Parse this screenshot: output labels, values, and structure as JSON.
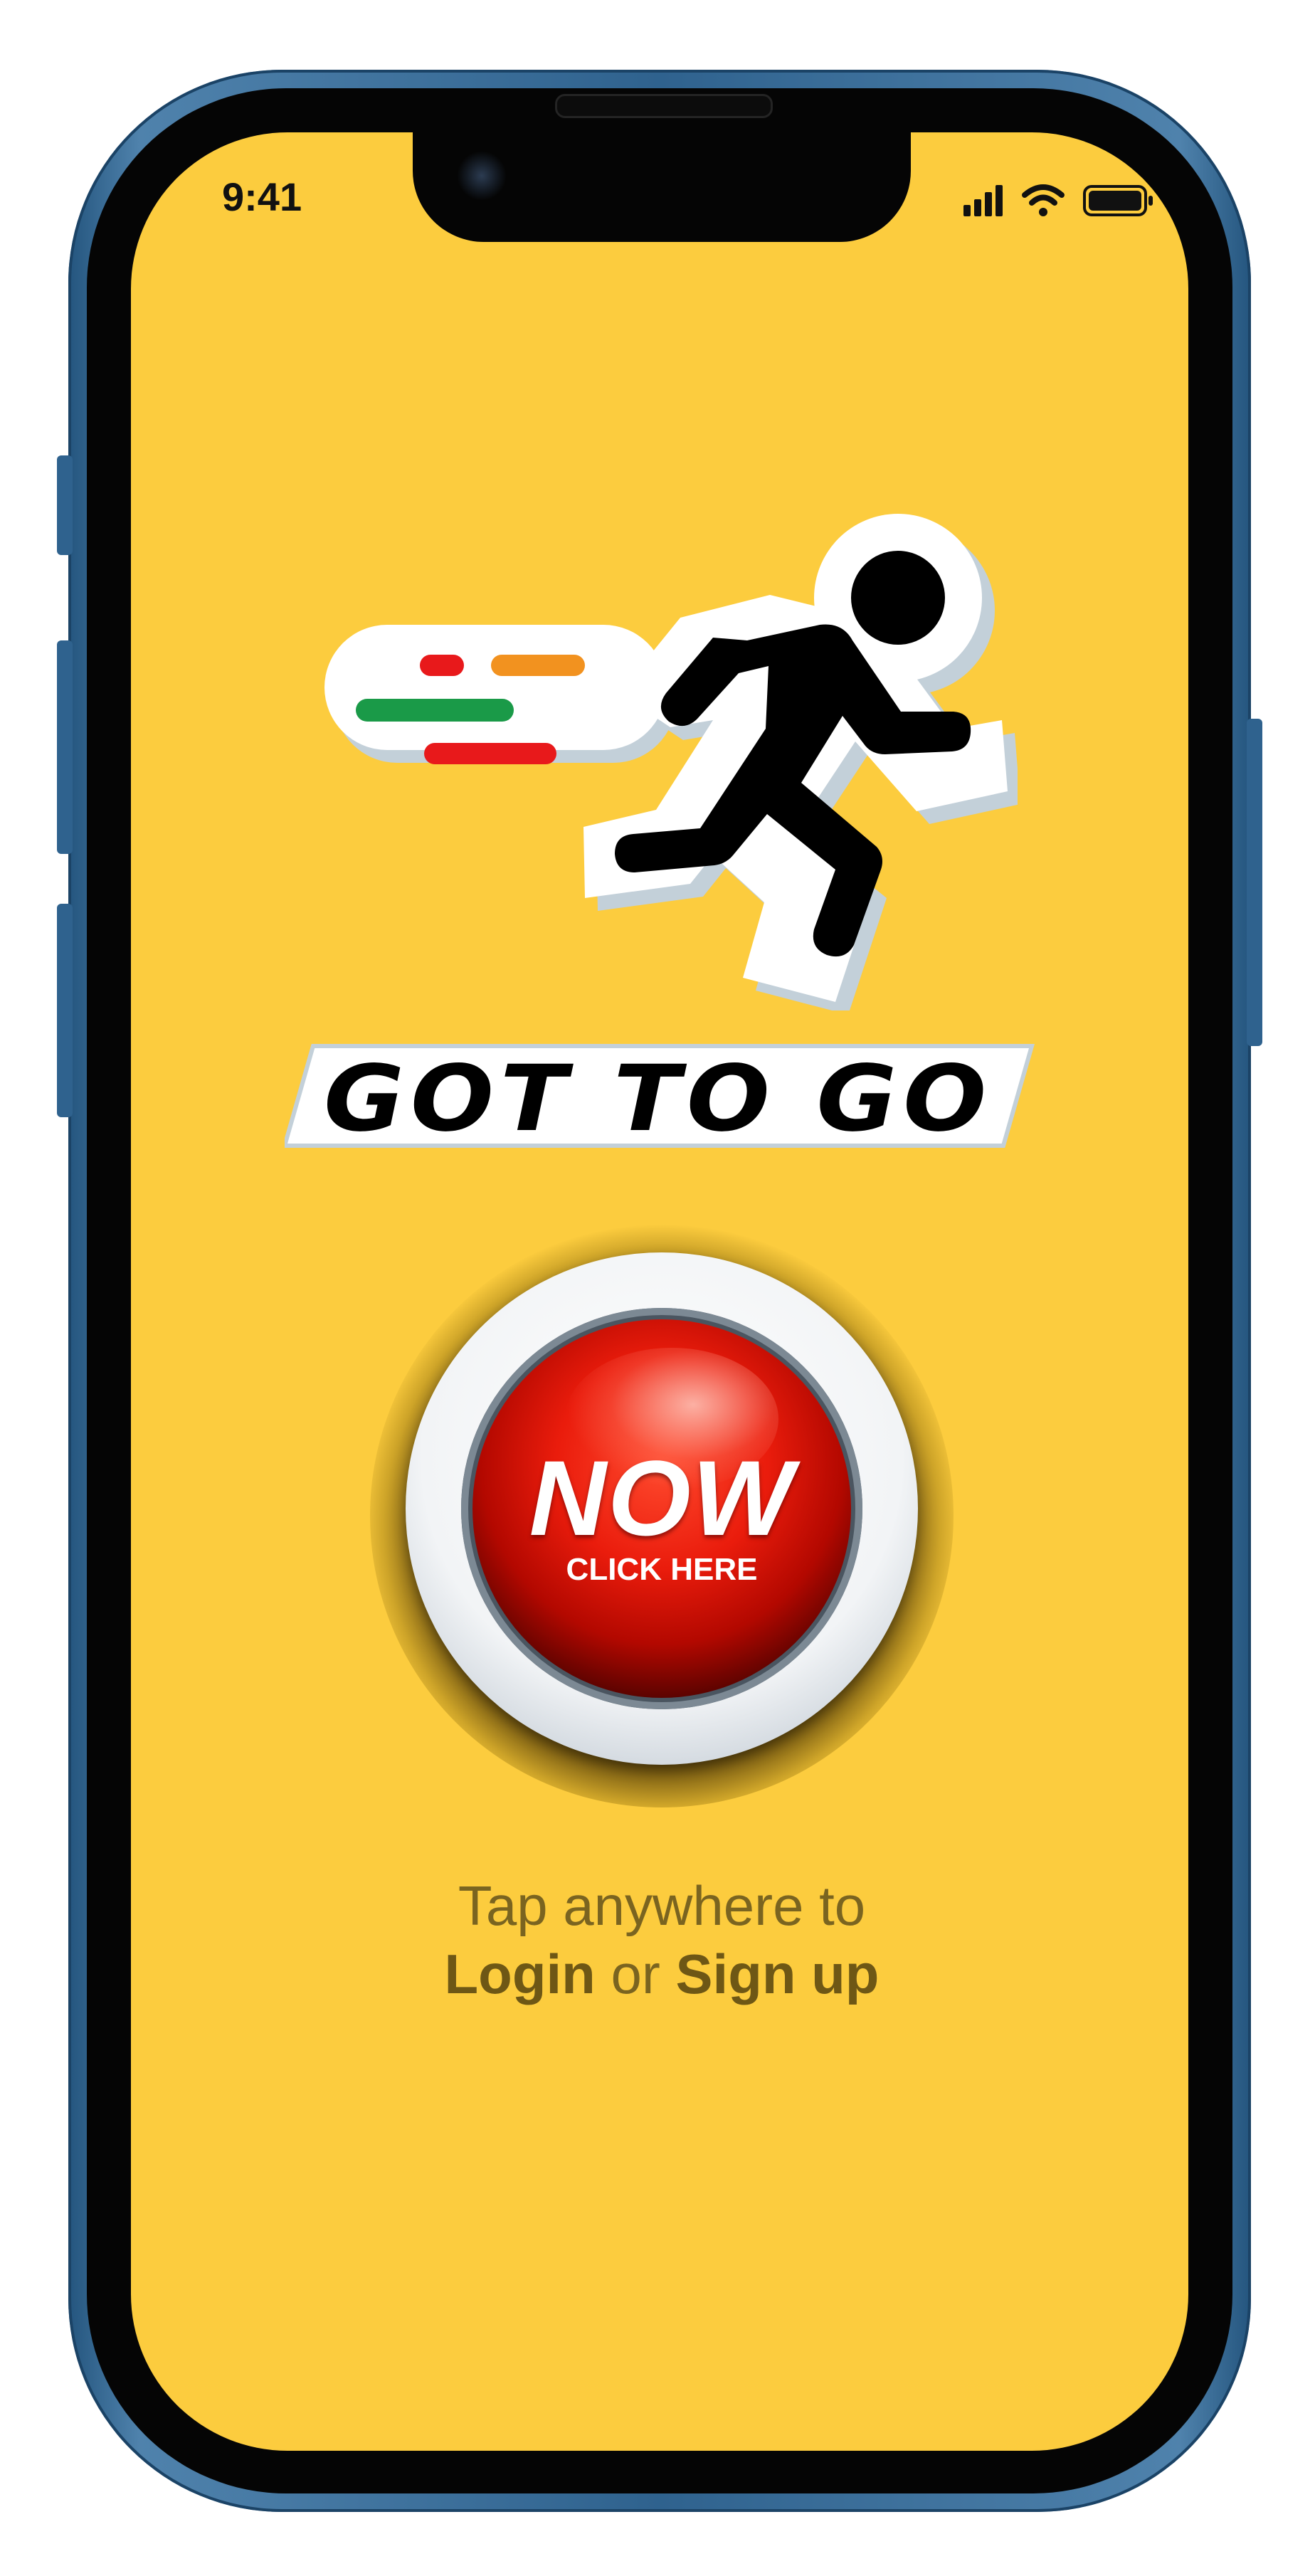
{
  "status_bar": {
    "time": "9:41",
    "icons": [
      "cellular-signal-icon",
      "wifi-icon",
      "battery-icon"
    ]
  },
  "brand": {
    "name": "GOT TO GO",
    "colors": {
      "background": "#fccc3e",
      "speed_lines": [
        "#e8191b",
        "#f2921f",
        "#1a9a48",
        "#e8191b"
      ]
    }
  },
  "now_button": {
    "label": "NOW",
    "sublabel": "CLICK HERE"
  },
  "prompt": {
    "line1": "Tap anywhere to",
    "login": "Login",
    "or": "or",
    "signup": "Sign up"
  }
}
